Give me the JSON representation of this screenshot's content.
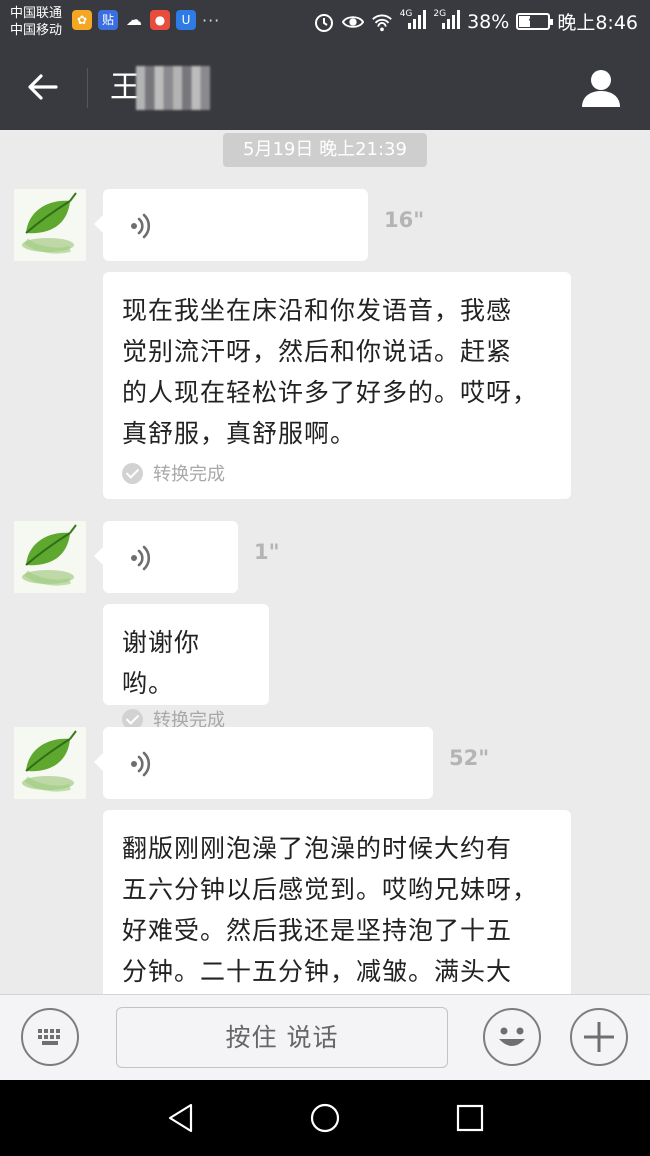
{
  "status_bar": {
    "carrier_1": "中国联通",
    "carrier_2": "中国移动",
    "app_icons": [
      "baidu-icon",
      "tieba-icon",
      "weather-icon",
      "map-icon",
      "security-icon"
    ],
    "more": "···",
    "net_4g": "4G",
    "net_2g": "2G",
    "battery_text": "38%",
    "battery_level": 0.38,
    "time": "晚上8:46"
  },
  "header": {
    "title": "王",
    "back_icon": "back-arrow-icon",
    "profile_icon": "person-icon"
  },
  "chat": {
    "timestamp": "5月19日 晚上21:39",
    "messages": [
      {
        "duration": "16\"",
        "text_lines": [
          "现在我坐在床沿和你发语音，我感",
          "觉别流汗呀，然后和你说话。赶紧",
          "的人现在轻松许多了好多的。哎呀，",
          "真舒服，真舒服啊。"
        ],
        "status": "转换完成"
      },
      {
        "duration": "1\"",
        "text_lines": [
          "谢谢你哟。"
        ],
        "status": "转换完成"
      },
      {
        "duration": "52\"",
        "text_lines": [
          "翻版刚刚泡澡了泡澡的时候大约有",
          "五六分钟以后感觉到。哎哟兄妹呀，",
          "好难受。然后我还是坚持泡了十五",
          "分钟。二十五分钟，减皱。满头大"
        ]
      }
    ]
  },
  "input_bar": {
    "hold_to_talk": "按住 说话",
    "keyboard_icon": "keyboard-icon",
    "emoji_icon": "emoji-icon",
    "plus_icon": "plus-icon"
  },
  "nav_bar": {
    "back": "nav-back-icon",
    "home": "nav-home-icon",
    "recents": "nav-recents-icon"
  },
  "colors": {
    "bar_dark": "#393a3f",
    "chat_bg": "#ebebeb",
    "bubble": "#ffffff",
    "muted": "#b4b4b4"
  }
}
